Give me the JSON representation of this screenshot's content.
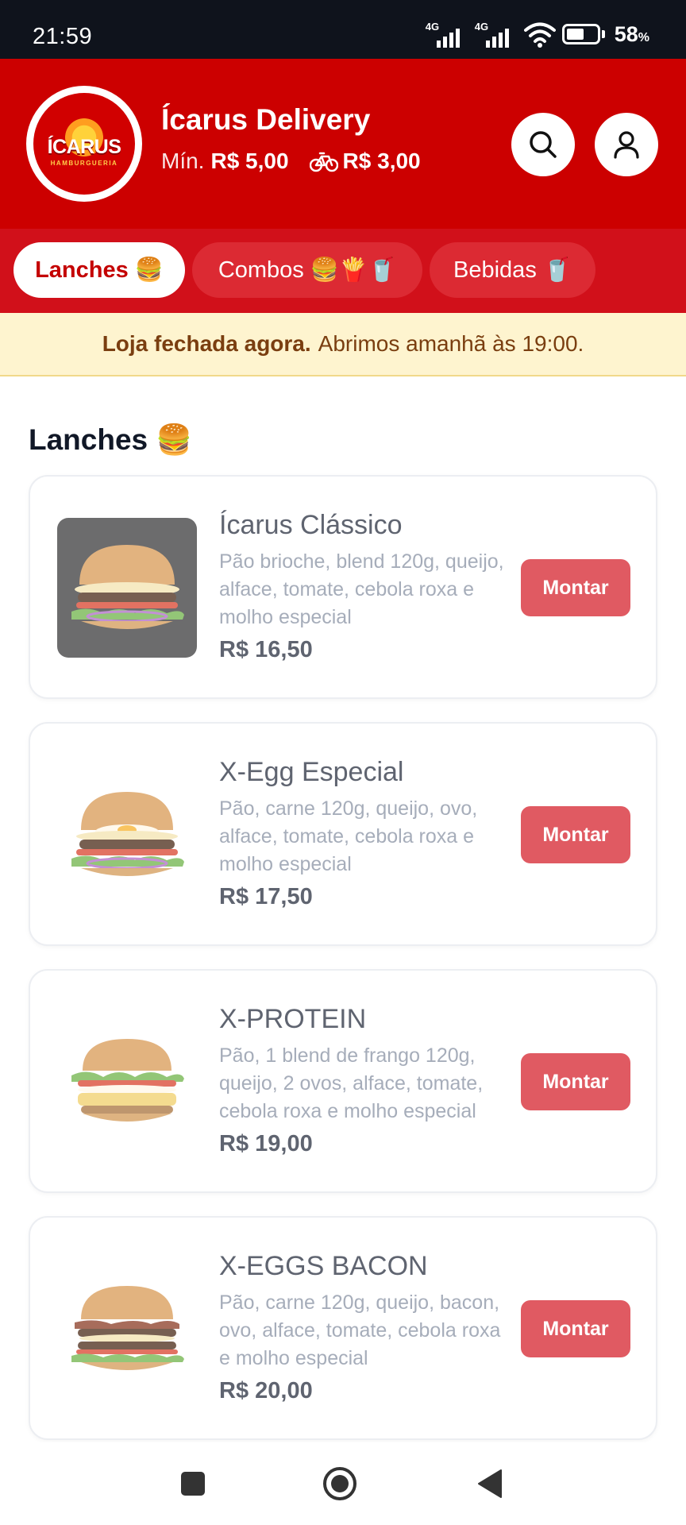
{
  "status_bar": {
    "time": "21:59",
    "network_1": "4G",
    "network_2": "4G",
    "battery_level": 0.58,
    "battery_number": "58",
    "battery_unit": "%"
  },
  "header": {
    "logo_text": "ÍCARUS",
    "logo_subtext": "HAMBURGUERIA",
    "store_name": "Ícarus Delivery",
    "min_label": "Mín.",
    "min_value": "R$ 5,00",
    "delivery_fee": "R$ 3,00",
    "icons": {
      "search": "search-icon",
      "user": "user-icon",
      "delivery": "bicycle-icon"
    }
  },
  "tabs": [
    {
      "label": "Lanches 🍔",
      "active": true
    },
    {
      "label": "Combos 🍔🍟🥤",
      "active": false
    },
    {
      "label": "Bebidas 🥤",
      "active": false
    }
  ],
  "banner": {
    "bold": "Loja fechada agora.",
    "text": "Abrimos amanhã às 19:00."
  },
  "section": {
    "title": "Lanches 🍔"
  },
  "products": [
    {
      "name": "Ícarus Clássico",
      "description": "Pão brioche, blend 120g, queijo, alface, tomate, cebola roxa e molho especial",
      "price": "R$ 16,50",
      "button": "Montar"
    },
    {
      "name": "X-Egg Especial",
      "description": "Pão, carne 120g, queijo, ovo, alface, tomate, cebola roxa e molho especial",
      "price": "R$ 17,50",
      "button": "Montar"
    },
    {
      "name": "X-PROTEIN",
      "description": "Pão, 1 blend de frango 120g, queijo, 2 ovos, alface, tomate, cebola roxa e molho especial",
      "price": "R$ 19,00",
      "button": "Montar"
    },
    {
      "name": "X-EGGS BACON",
      "description": "Pão, carne 120g, queijo, bacon, ovo, alface, tomate, cebola roxa e molho especial",
      "price": "R$ 20,00",
      "button": "Montar"
    }
  ],
  "colors": {
    "brand_red": "#cc0000",
    "tab_bar": "#d1101a",
    "button_red": "#e05a62",
    "banner_bg": "#fef4cf",
    "banner_text": "#7a3e10"
  },
  "navbar": {
    "icons": [
      "recents-icon",
      "home-icon",
      "back-icon"
    ]
  }
}
